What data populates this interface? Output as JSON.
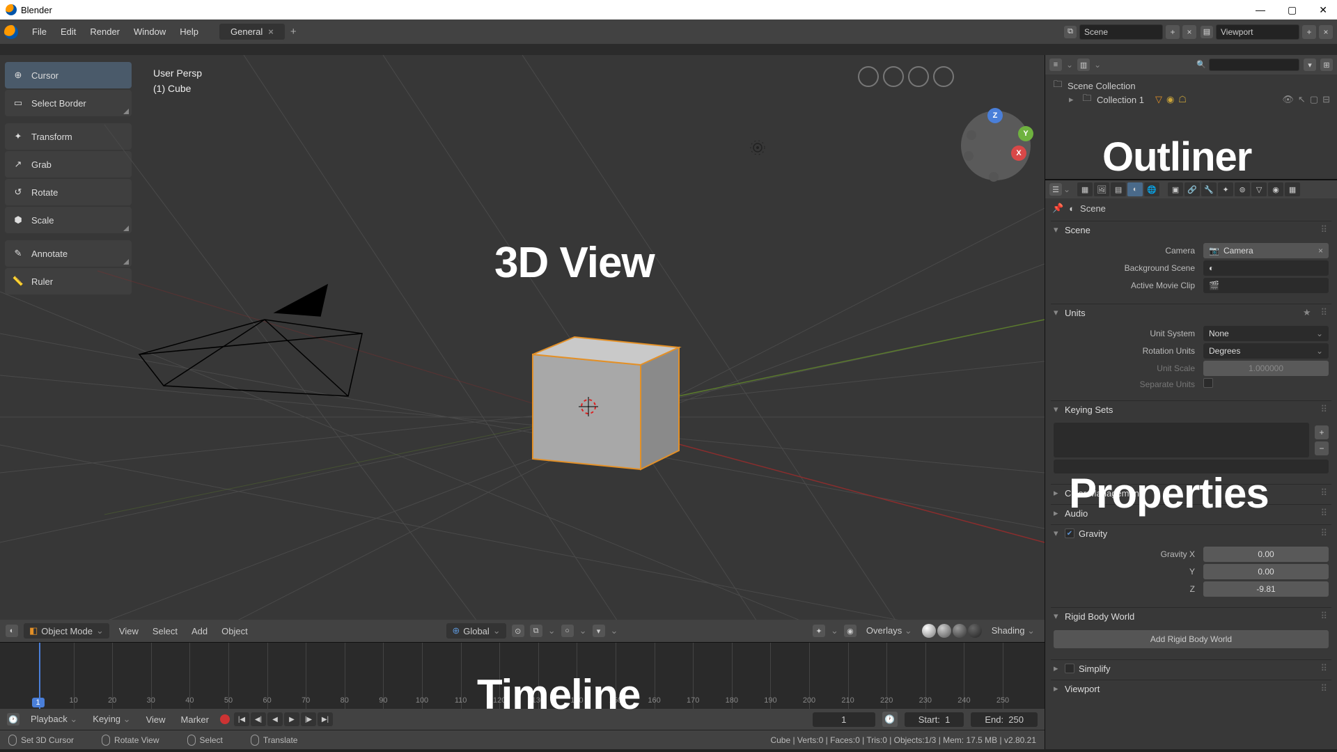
{
  "titlebar": {
    "title": "Blender"
  },
  "menubar": {
    "items": [
      "File",
      "Edit",
      "Render",
      "Window",
      "Help"
    ],
    "workspace": "General",
    "scene_label": "Scene",
    "viewlayer_label": "Viewport"
  },
  "toolbar": [
    {
      "label": "Cursor",
      "icon": "⊕",
      "active": true,
      "corner": false
    },
    {
      "label": "Select Border",
      "icon": "▭",
      "active": false,
      "corner": true
    },
    {
      "sep": true
    },
    {
      "label": "Transform",
      "icon": "✦",
      "active": false,
      "corner": false
    },
    {
      "label": "Grab",
      "icon": "↗",
      "active": false,
      "corner": false
    },
    {
      "label": "Rotate",
      "icon": "↺",
      "active": false,
      "corner": false
    },
    {
      "label": "Scale",
      "icon": "⬢",
      "active": false,
      "corner": true
    },
    {
      "sep": true
    },
    {
      "label": "Annotate",
      "icon": "✎",
      "active": false,
      "corner": true
    },
    {
      "label": "Ruler",
      "icon": "📏",
      "active": false,
      "corner": false
    }
  ],
  "viewport": {
    "info_line1": "User Persp",
    "info_line2": "(1) Cube",
    "label_3d": "3D View"
  },
  "v3d_header": {
    "mode": "Object Mode",
    "menus": [
      "View",
      "Select",
      "Add",
      "Object"
    ],
    "orientation": "Global",
    "overlays": "Overlays",
    "shading": "Shading"
  },
  "timeline": {
    "label": "Timeline",
    "header_menus": [
      "Playback",
      "Keying",
      "View",
      "Marker"
    ],
    "current_frame": "1",
    "start_label": "Start:",
    "start": "1",
    "end_label": "End:",
    "end": "250",
    "ticks": [
      10,
      20,
      30,
      40,
      50,
      60,
      70,
      80,
      90,
      100,
      110,
      120,
      130,
      140,
      150,
      160,
      170,
      180,
      190,
      200,
      210,
      220,
      230,
      240,
      250
    ]
  },
  "status": {
    "left": "Set 3D Cursor",
    "mid1": "Rotate View",
    "mid2": "Select",
    "mid3": "Translate",
    "right": "Cube | Verts:0 | Faces:0 | Tris:0 | Objects:1/3 | Mem: 17.5 MB | v2.80.21"
  },
  "outliner": {
    "label": "Outliner",
    "scene_collection": "Scene Collection",
    "collection": "Collection 1"
  },
  "properties": {
    "label": "Properties",
    "crumb": "Scene",
    "panels": {
      "scene": {
        "title": "Scene",
        "open": true,
        "camera_label": "Camera",
        "camera_val": "Camera",
        "bgscene_label": "Background Scene",
        "movieclip_label": "Active Movie Clip"
      },
      "units": {
        "title": "Units",
        "open": true,
        "system_label": "Unit System",
        "system_val": "None",
        "rot_label": "Rotation Units",
        "rot_val": "Degrees",
        "scale_label": "Unit Scale",
        "scale_val": "1.000000",
        "separate_label": "Separate Units"
      },
      "keying": {
        "title": "Keying Sets",
        "open": true
      },
      "color": {
        "title": "Color Management",
        "open": false
      },
      "audio": {
        "title": "Audio",
        "open": false
      },
      "gravity": {
        "title": "Gravity",
        "open": true,
        "checked": true,
        "x_label": "Gravity X",
        "x": "0.00",
        "y_label": "Y",
        "y": "0.00",
        "z_label": "Z",
        "z": "-9.81"
      },
      "rigid": {
        "title": "Rigid Body World",
        "open": true,
        "btn": "Add Rigid Body World"
      },
      "simplify": {
        "title": "Simplify",
        "open": false,
        "checked": false
      },
      "viewport": {
        "title": "Viewport",
        "open": false
      }
    }
  }
}
